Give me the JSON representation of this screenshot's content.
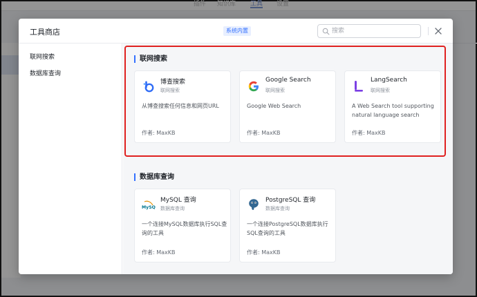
{
  "background": {
    "nav_items": [
      "插件",
      "知识库",
      "工具",
      "设置"
    ],
    "active_nav_index": 2
  },
  "dialog": {
    "title": "工具商店",
    "tag": "系统内置",
    "search_placeholder": "搜索",
    "sidebar": [
      "联网搜索",
      "数据库查询"
    ]
  },
  "sections": [
    {
      "title": "联网搜索",
      "cards": [
        {
          "name": "博查搜索",
          "category": "联网搜索",
          "description": "从博查搜索任何信息和网页URL",
          "author": "作者: MaxKB",
          "icon": "bocha-icon"
        },
        {
          "name": "Google Search",
          "category": "联网搜索",
          "description": "Google Web Search",
          "author": "作者: MaxKB",
          "icon": "google-icon"
        },
        {
          "name": "LangSearch",
          "category": "联网搜索",
          "description": "A Web Search tool supporting natural language search",
          "author": "作者: MaxKB",
          "icon": "langsearch-icon"
        }
      ]
    },
    {
      "title": "数据库查询",
      "cards": [
        {
          "name": "MySQL 查询",
          "category": "数据库查询",
          "description": "一个连接MySQL数据库执行SQL查询的工具",
          "author": "作者: MaxKB",
          "icon": "mysql-icon"
        },
        {
          "name": "PostgreSQL 查询",
          "category": "数据库查询",
          "description": "一个连接PostgreSQL数据库执行SQL查询的工具",
          "author": "作者: MaxKB",
          "icon": "postgresql-icon"
        }
      ]
    }
  ],
  "colors": {
    "accent": "#3370ff",
    "highlight": "#e0201f"
  }
}
